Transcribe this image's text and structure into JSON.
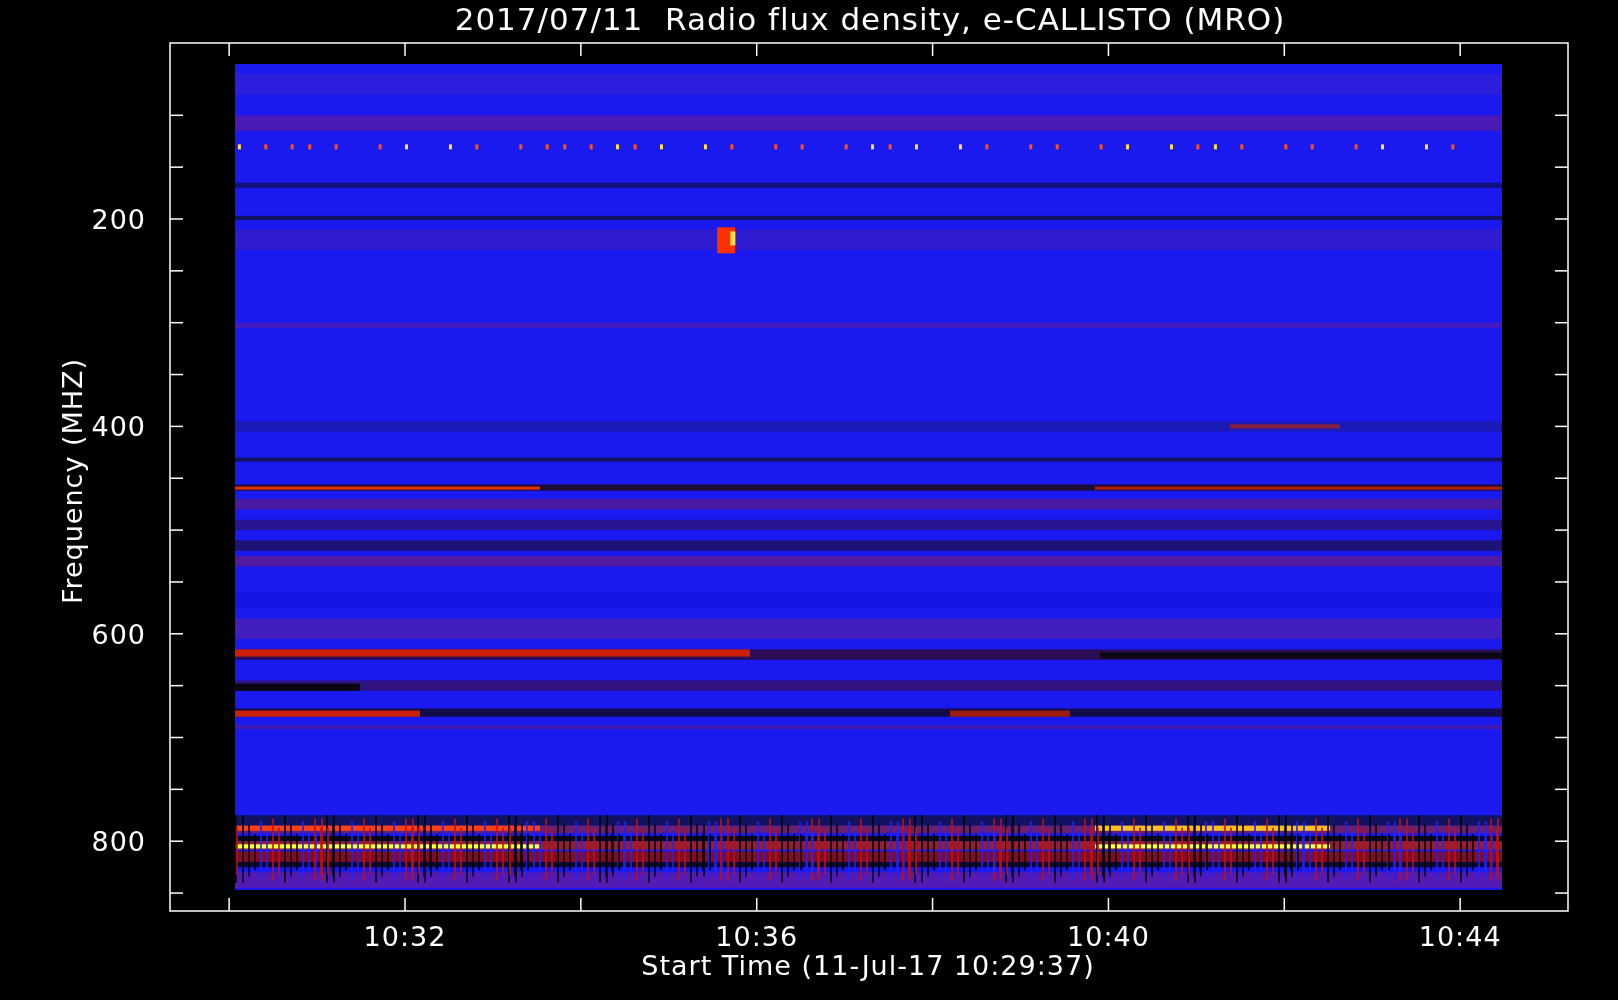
{
  "title": "2017/07/11  Radio flux density, e-CALLISTO (MRO)",
  "y_axis": {
    "label": "Frequency (MHZ)",
    "ticks": [
      "200",
      "400",
      "600",
      "800"
    ]
  },
  "x_axis": {
    "label": "Start Time (11-Jul-17 10:29:37)",
    "ticks": [
      "10:32",
      "10:36",
      "10:40",
      "10:44"
    ]
  }
}
